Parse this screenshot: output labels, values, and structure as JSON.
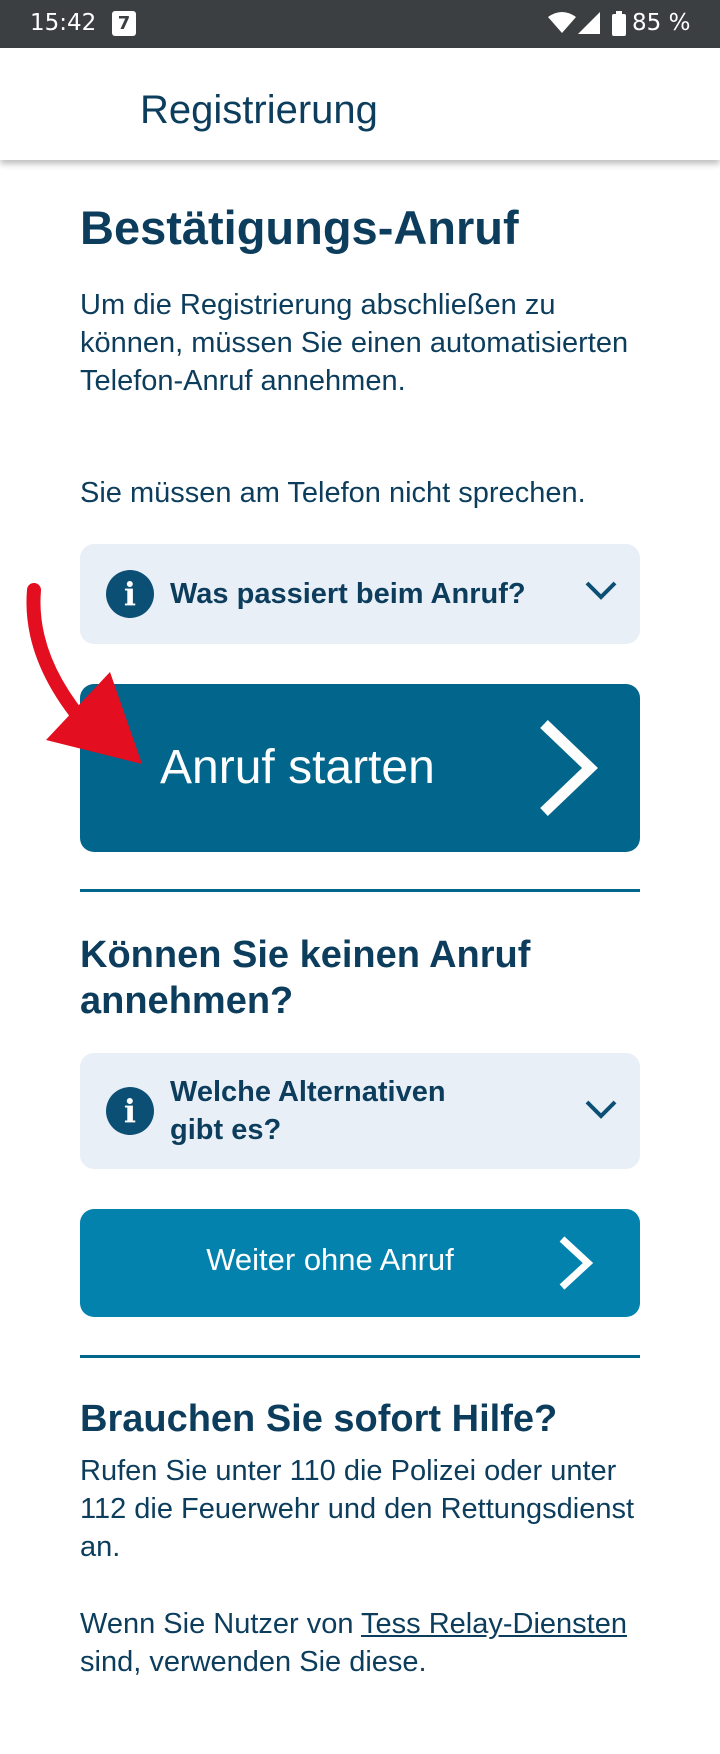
{
  "status_bar": {
    "time": "15:42",
    "calendar_day": "7",
    "battery_percent": "85 %"
  },
  "app_bar": {
    "title": "Registrierung"
  },
  "main": {
    "heading": "Bestätigungs-Anruf",
    "intro": "Um die Registrierung abschließen zu können, müssen Sie einen automatisierten Telefon-Anruf annehmen.",
    "no_speaking": "Sie müssen am Telefon nicht sprechen.",
    "accordion_call": "Was passiert beim Anruf?",
    "start_call_button": "Anruf starten",
    "alt_heading": "Können Sie keinen Anruf annehmen?",
    "accordion_alternatives": "Welche Alternativen gibt es?",
    "continue_without_call_button": "Weiter ohne Anruf",
    "help_heading": "Brauchen Sie sofort Hilfe?",
    "help_text": "Rufen Sie unter 110 die Polizei oder unter 112 die Feuerwehr und den Rettungsdienst an.",
    "relay_prefix": "Wenn Sie Nutzer von ",
    "relay_link": "Tess Relay-Diensten",
    "relay_suffix": " sind, verwenden Sie diese."
  },
  "colors": {
    "primary": "#02658b",
    "secondary": "#0282ad",
    "text": "#0c3d5c",
    "accordion_bg": "#e9eff7",
    "annotation_arrow": "#e30e1f"
  }
}
